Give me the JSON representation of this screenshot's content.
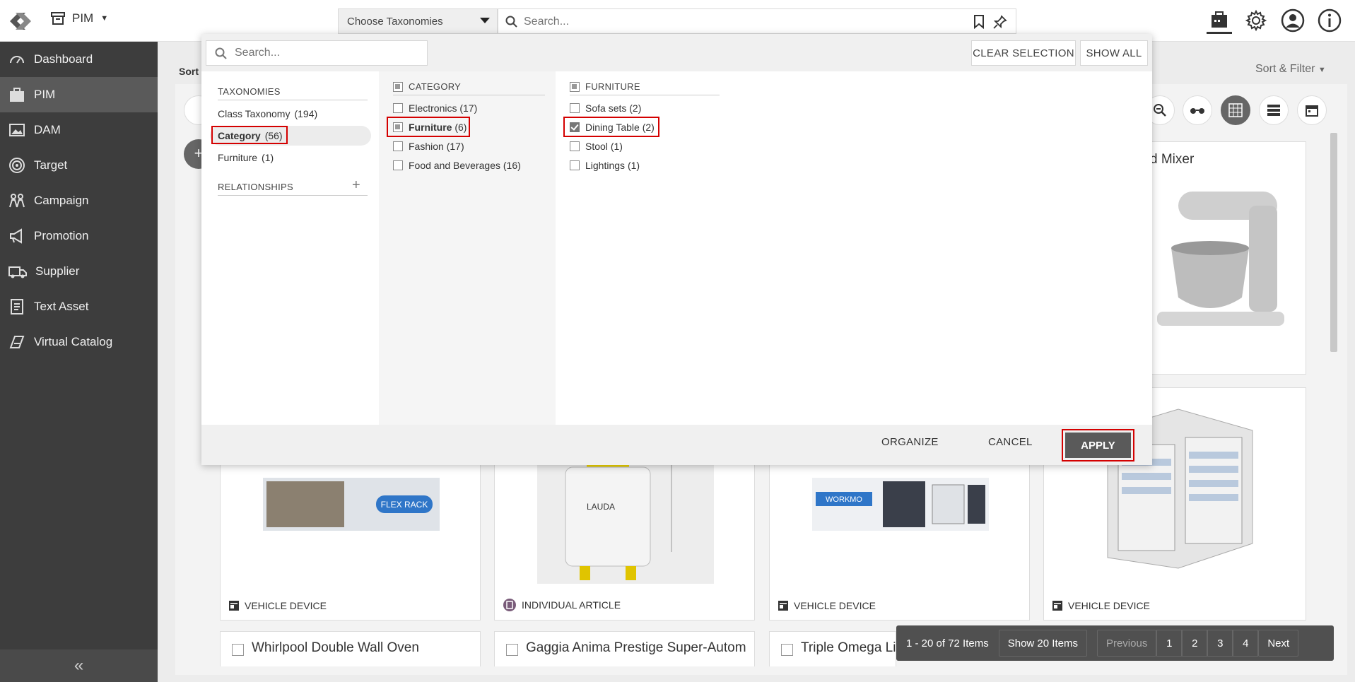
{
  "header": {
    "app_name": "PIM",
    "taxonomy_select": "Choose Taxonomies",
    "search_placeholder": "Search..."
  },
  "sidebar": {
    "items": [
      {
        "label": "Dashboard",
        "icon": "dashboard-icon"
      },
      {
        "label": "PIM",
        "icon": "pim-icon",
        "active": true
      },
      {
        "label": "DAM",
        "icon": "image-icon"
      },
      {
        "label": "Target",
        "icon": "target-icon"
      },
      {
        "label": "Campaign",
        "icon": "campaign-icon"
      },
      {
        "label": "Promotion",
        "icon": "megaphone-icon"
      },
      {
        "label": "Supplier",
        "icon": "truck-icon"
      },
      {
        "label": "Text Asset",
        "icon": "document-icon"
      },
      {
        "label": "Virtual Catalog",
        "icon": "catalog-icon"
      }
    ]
  },
  "main": {
    "sort_label": "Sort",
    "sort_filter": "Sort & Filter",
    "cards": [
      {
        "title": "d Mixer"
      },
      {
        "type": "VEHICLE DEVICE"
      },
      {
        "type": "INDIVIDUAL ARTICLE"
      },
      {
        "type": "VEHICLE DEVICE"
      },
      {
        "type": "VEHICLE DEVICE"
      }
    ],
    "bottom_titles": [
      "Whirlpool Double Wall Oven",
      "Gaggia Anima Prestige Super-Autom",
      "Triple Omega Li"
    ]
  },
  "pager": {
    "range": "1 - 20 of 72 Items",
    "show": "Show 20 Items",
    "previous": "Previous",
    "pages": [
      "1",
      "2",
      "3",
      "4"
    ],
    "next": "Next"
  },
  "overlay": {
    "search_placeholder": "Search...",
    "clear_selection": "CLEAR SELECTION",
    "show_all": "SHOW ALL",
    "taxonomies_title": "TAXONOMIES",
    "taxonomies": [
      {
        "label": "Class Taxonomy",
        "count": "(194)"
      },
      {
        "label": "Category",
        "count": "(56)"
      },
      {
        "label": "Furniture",
        "count": "(1)"
      }
    ],
    "relationships_title": "RELATIONSHIPS",
    "category_title": "CATEGORY",
    "category_items": [
      {
        "label": "Electronics",
        "count": "(17)"
      },
      {
        "label": "Furniture",
        "count": "(6)"
      },
      {
        "label": "Fashion",
        "count": "(17)"
      },
      {
        "label": "Food and Beverages",
        "count": "(16)"
      }
    ],
    "furniture_title": "FURNITURE",
    "furniture_items": [
      {
        "label": "Sofa sets",
        "count": "(2)"
      },
      {
        "label": "Dining Table",
        "count": "(2)"
      },
      {
        "label": "Stool",
        "count": "(1)"
      },
      {
        "label": "Lightings",
        "count": "(1)"
      }
    ],
    "organize": "ORGANIZE",
    "cancel": "CANCEL",
    "apply": "APPLY"
  }
}
